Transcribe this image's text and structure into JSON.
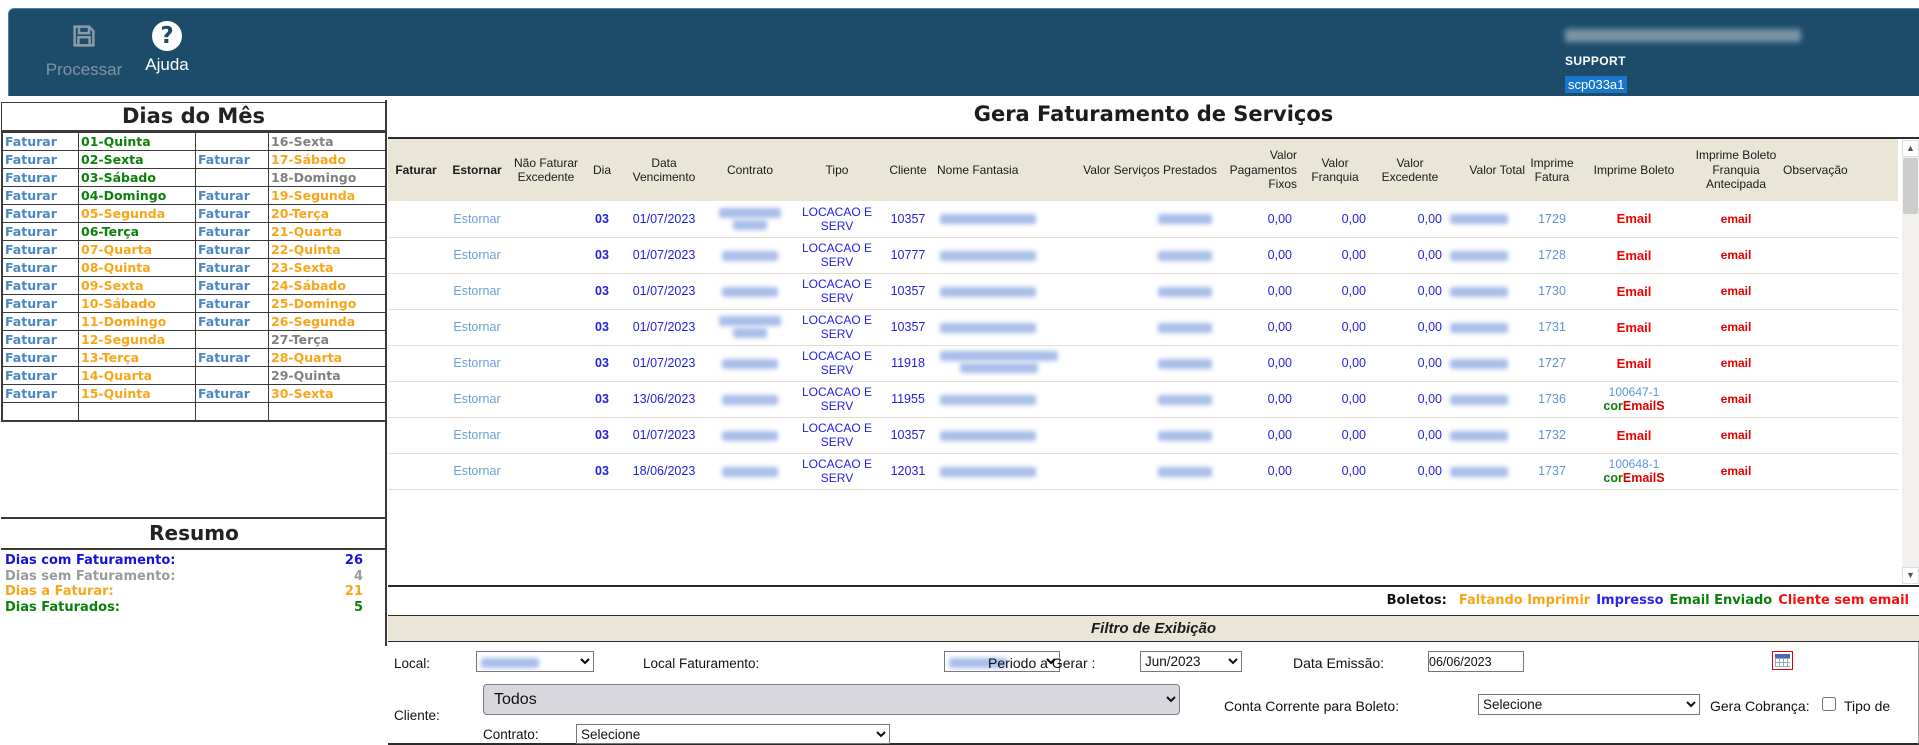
{
  "header": {
    "processar_label": "Processar",
    "ajuda_label": "Ajuda",
    "support_label": "SUPPORT",
    "session_id": "scp033a1",
    "bar_color": "#1d4c6a"
  },
  "dias_do_mes": {
    "title": "Dias do Mês",
    "faturar_label": "Faturar",
    "status_colors": {
      "green": "#0b800b",
      "orange": "#f9a51a",
      "gray": "#808080"
    },
    "rows": [
      {
        "l_fat": true,
        "l_day": "01-Quinta",
        "l_st": "green",
        "r_fat": false,
        "r_day": "16-Sexta",
        "r_st": "gray"
      },
      {
        "l_fat": true,
        "l_day": "02-Sexta",
        "l_st": "green",
        "r_fat": true,
        "r_day": "17-Sábado",
        "r_st": "orange"
      },
      {
        "l_fat": true,
        "l_day": "03-Sábado",
        "l_st": "green",
        "r_fat": false,
        "r_day": "18-Domingo",
        "r_st": "gray"
      },
      {
        "l_fat": true,
        "l_day": "04-Domingo",
        "l_st": "green",
        "r_fat": true,
        "r_day": "19-Segunda",
        "r_st": "orange"
      },
      {
        "l_fat": true,
        "l_day": "05-Segunda",
        "l_st": "orange",
        "r_fat": true,
        "r_day": "20-Terça",
        "r_st": "orange"
      },
      {
        "l_fat": true,
        "l_day": "06-Terça",
        "l_st": "green",
        "r_fat": true,
        "r_day": "21-Quarta",
        "r_st": "orange"
      },
      {
        "l_fat": true,
        "l_day": "07-Quarta",
        "l_st": "orange",
        "r_fat": true,
        "r_day": "22-Quinta",
        "r_st": "orange"
      },
      {
        "l_fat": true,
        "l_day": "08-Quinta",
        "l_st": "orange",
        "r_fat": true,
        "r_day": "23-Sexta",
        "r_st": "orange"
      },
      {
        "l_fat": true,
        "l_day": "09-Sexta",
        "l_st": "orange",
        "r_fat": true,
        "r_day": "24-Sábado",
        "r_st": "orange"
      },
      {
        "l_fat": true,
        "l_day": "10-Sábado",
        "l_st": "orange",
        "r_fat": true,
        "r_day": "25-Domingo",
        "r_st": "orange"
      },
      {
        "l_fat": true,
        "l_day": "11-Domingo",
        "l_st": "orange",
        "r_fat": true,
        "r_day": "26-Segunda",
        "r_st": "orange"
      },
      {
        "l_fat": true,
        "l_day": "12-Segunda",
        "l_st": "orange",
        "r_fat": false,
        "r_day": "27-Terça",
        "r_st": "gray"
      },
      {
        "l_fat": true,
        "l_day": "13-Terça",
        "l_st": "orange",
        "r_fat": true,
        "r_day": "28-Quarta",
        "r_st": "orange"
      },
      {
        "l_fat": true,
        "l_day": "14-Quarta",
        "l_st": "orange",
        "r_fat": false,
        "r_day": "29-Quinta",
        "r_st": "gray"
      },
      {
        "l_fat": true,
        "l_day": "15-Quinta",
        "l_st": "orange",
        "r_fat": true,
        "r_day": "30-Sexta",
        "r_st": "orange"
      },
      {
        "l_fat": false,
        "l_day": "",
        "l_st": "gray",
        "r_fat": false,
        "r_day": "",
        "r_st": "gray"
      }
    ]
  },
  "resumo": {
    "title": "Resumo",
    "items": [
      {
        "label": "Dias com Faturamento:",
        "value": "26",
        "color": "blue"
      },
      {
        "label": "Dias sem Faturamento:",
        "value": "4",
        "color": "gray"
      },
      {
        "label": "Dias a Faturar:",
        "value": "21",
        "color": "orange"
      },
      {
        "label": "Dias Faturados:",
        "value": "5",
        "color": "green"
      }
    ]
  },
  "main_table": {
    "title": "Gera Faturamento de Serviços",
    "columns": [
      "Faturar",
      "Estornar",
      "Não Faturar Excedente",
      "Dia",
      "Data Vencimento",
      "Contrato",
      "Tipo",
      "Cliente",
      "Nome Fantasia",
      "Valor Serviços Prestados",
      "Valor Pagamentos Fixos",
      "Valor Franquia",
      "Valor Excedente",
      "Valor Total",
      "Imprime Fatura",
      "Imprime Boleto",
      "Imprime Boleto Franquia Antecipada",
      "Observação"
    ],
    "rows": [
      {
        "estornar": "Estornar",
        "dia": "03",
        "data": "01/07/2023",
        "contrato_lines": 2,
        "tipo": "LOCACAO E SERV",
        "cliente": "10357",
        "nome_lines": 1,
        "pagamentos_fixos": "0,00",
        "franquia": "0,00",
        "excedente": "0,00",
        "fatura": "1729",
        "boleto": {
          "email": "Email"
        },
        "bfa": "email"
      },
      {
        "estornar": "Estornar",
        "dia": "03",
        "data": "01/07/2023",
        "contrato_lines": 1,
        "tipo": "LOCACAO E SERV",
        "cliente": "10777",
        "nome_lines": 1,
        "pagamentos_fixos": "0,00",
        "franquia": "0,00",
        "excedente": "0,00",
        "fatura": "1728",
        "boleto": {
          "email": "Email"
        },
        "bfa": "email"
      },
      {
        "estornar": "Estornar",
        "dia": "03",
        "data": "01/07/2023",
        "contrato_lines": 1,
        "tipo": "LOCACAO E SERV",
        "cliente": "10357",
        "nome_lines": 1,
        "pagamentos_fixos": "0,00",
        "franquia": "0,00",
        "excedente": "0,00",
        "fatura": "1730",
        "boleto": {
          "email": "Email"
        },
        "bfa": "email"
      },
      {
        "estornar": "Estornar",
        "dia": "03",
        "data": "01/07/2023",
        "contrato_lines": 2,
        "tipo": "LOCACAO E SERV",
        "cliente": "10357",
        "nome_lines": 1,
        "pagamentos_fixos": "0,00",
        "franquia": "0,00",
        "excedente": "0,00",
        "fatura": "1731",
        "boleto": {
          "email": "Email"
        },
        "bfa": "email"
      },
      {
        "estornar": "Estornar",
        "dia": "03",
        "data": "01/07/2023",
        "contrato_lines": 1,
        "tipo": "LOCACAO E SERV",
        "cliente": "11918",
        "nome_lines": 2,
        "pagamentos_fixos": "0,00",
        "franquia": "0,00",
        "excedente": "0,00",
        "fatura": "1727",
        "boleto": {
          "email": "Email"
        },
        "bfa": "email"
      },
      {
        "estornar": "Estornar",
        "dia": "03",
        "data": "13/06/2023",
        "contrato_lines": 1,
        "tipo": "LOCACAO E SERV",
        "cliente": "11955",
        "nome_lines": 1,
        "pagamentos_fixos": "0,00",
        "franquia": "0,00",
        "excedente": "0,00",
        "fatura": "1736",
        "boleto": {
          "num": "100647-1",
          "cor": "cor",
          "mails": "EmailS"
        },
        "bfa": "email"
      },
      {
        "estornar": "Estornar",
        "dia": "03",
        "data": "01/07/2023",
        "contrato_lines": 1,
        "tipo": "LOCACAO E SERV",
        "cliente": "10357",
        "nome_lines": 1,
        "pagamentos_fixos": "0,00",
        "franquia": "0,00",
        "excedente": "0,00",
        "fatura": "1732",
        "boleto": {
          "email": "Email"
        },
        "bfa": "email"
      },
      {
        "estornar": "Estornar",
        "dia": "03",
        "data": "18/06/2023",
        "contrato_lines": 1,
        "tipo": "LOCACAO E SERV",
        "cliente": "12031",
        "nome_lines": 1,
        "pagamentos_fixos": "0,00",
        "franquia": "0,00",
        "excedente": "0,00",
        "fatura": "1737",
        "boleto": {
          "num": "100648-1",
          "cor": "cor",
          "mails": "EmailS"
        },
        "bfa": "email"
      }
    ],
    "legend": {
      "prefix": "Boletos:",
      "items": [
        {
          "label": "Faltando Imprimir",
          "color": "#f9a51a"
        },
        {
          "label": "Impresso",
          "color": "#2727e8"
        },
        {
          "label": "Email Enviado",
          "color": "#0b800b"
        },
        {
          "label": "Cliente sem email",
          "color": "#f21010"
        }
      ]
    }
  },
  "filtro": {
    "title": "Filtro de Exibição",
    "local_label": "Local:",
    "local_faturamento_label": "Local Faturamento:",
    "periodo_label": "Periodo a Gerar :",
    "periodo_value": "Jun/2023",
    "data_emissao_label": "Data Emissão:",
    "data_emissao_value": "06/06/2023",
    "cliente_label": "Cliente:",
    "cliente_value": "Todos",
    "contrato_label": "Contrato:",
    "contrato_value": "Selecione",
    "conta_label": "Conta Corrente para Boleto:",
    "conta_value": "Selecione",
    "gera_cobranca_label": "Gera Cobrança:",
    "tipo_de_label": "Tipo de"
  }
}
